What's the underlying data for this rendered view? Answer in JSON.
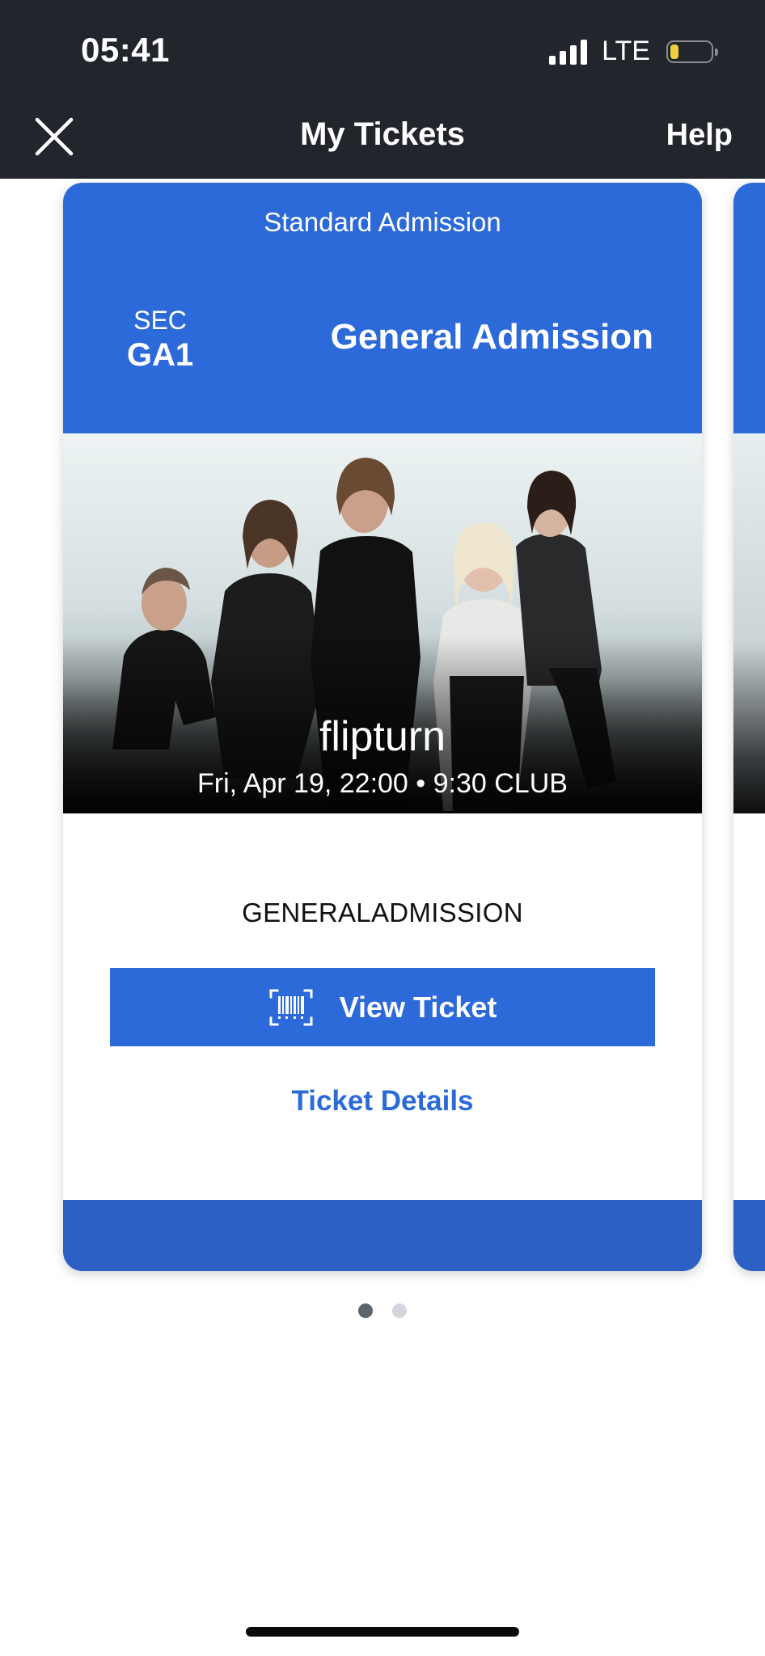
{
  "status_bar": {
    "time": "05:41",
    "network": "LTE",
    "battery_level": 0.2,
    "battery_color": "#f1cf3a"
  },
  "nav": {
    "title": "My Tickets",
    "close_icon": "close-icon",
    "help_label": "Help"
  },
  "ticket": {
    "admission_type": "Standard Admission",
    "section_label": "SEC",
    "section_value": "GA1",
    "seat_type": "General Admission",
    "artist": "flipturn",
    "event_info": "Fri, Apr 19, 22:00 • 9:30 CLUB",
    "entry_label": "GENERALADMISSION",
    "view_ticket_label": "View Ticket",
    "view_ticket_icon": "barcode-icon",
    "details_label": "Ticket Details"
  },
  "pager": {
    "count": 2,
    "active_index": 0
  },
  "colors": {
    "accent": "#2c69d9",
    "topbar": "#22252c"
  }
}
